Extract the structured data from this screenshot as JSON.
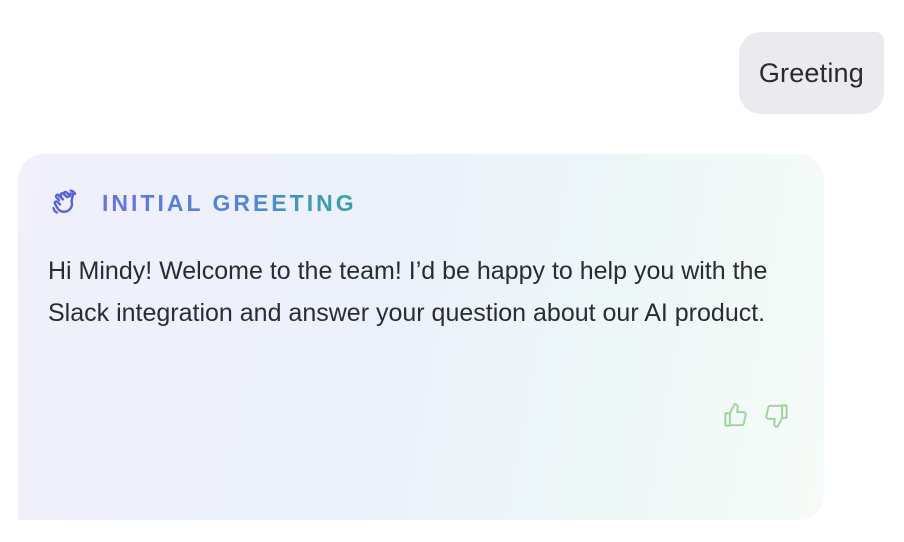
{
  "user_message": {
    "text": "Greeting"
  },
  "assistant_card": {
    "icon": "waving-hand-icon",
    "title": "INITIAL GREETING",
    "message": "Hi Mindy! Welcome to the team! I’d be happy to help you with the Slack integration and answer your question about our AI product.",
    "feedback": {
      "thumbs_up_icon": "thumbs-up-icon",
      "thumbs_down_icon": "thumbs-down-icon"
    }
  },
  "colors": {
    "user_bubble_bg": "#ebebef",
    "title_gradient_start": "#6673de",
    "title_gradient_end": "#38a3a0",
    "feedback_icon": "#9fd39a",
    "wave_icon": "#5b63d6"
  }
}
